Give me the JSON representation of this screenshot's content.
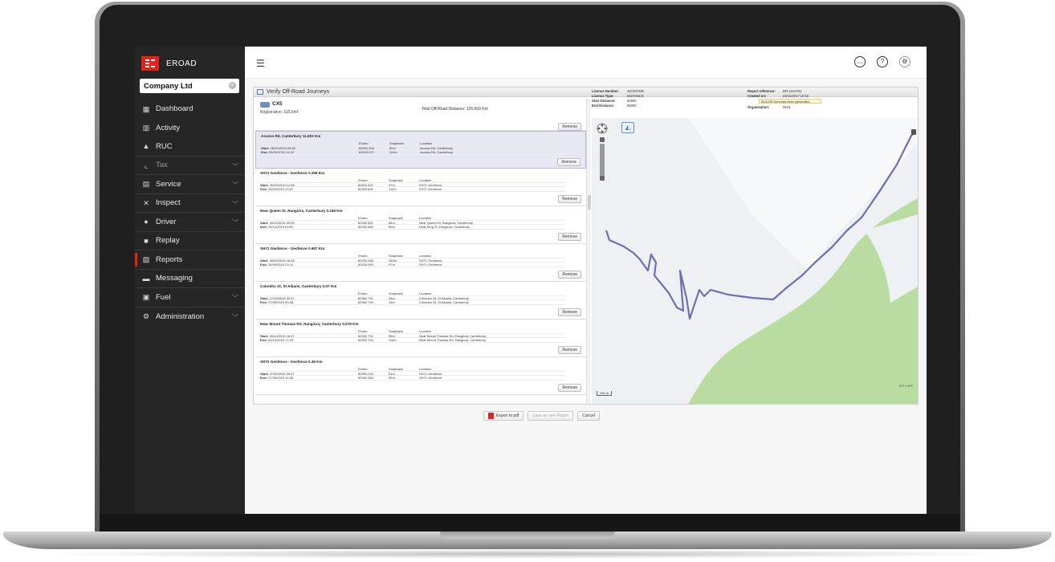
{
  "brand": {
    "name": "EROAD",
    "accent": "#e2231a"
  },
  "company": {
    "name": "Company Ltd"
  },
  "nav": {
    "items": [
      {
        "label": "Dashboard",
        "icon": "dashboard-icon"
      },
      {
        "label": "Activity",
        "icon": "activity-icon"
      },
      {
        "label": "RUC",
        "icon": "ruc-icon"
      },
      {
        "label": "Tax",
        "icon": "tax-icon"
      },
      {
        "label": "Service",
        "icon": "service-icon"
      },
      {
        "label": "Inspect",
        "icon": "inspect-icon"
      },
      {
        "label": "Driver",
        "icon": "driver-icon"
      },
      {
        "label": "Replay",
        "icon": "replay-icon"
      },
      {
        "label": "Reports",
        "icon": "reports-icon"
      },
      {
        "label": "Messaging",
        "icon": "messaging-icon"
      },
      {
        "label": "Fuel",
        "icon": "fuel-icon"
      },
      {
        "label": "Administration",
        "icon": "administration-icon"
      }
    ]
  },
  "panel": {
    "title": "Verify Off-Road Journeys"
  },
  "vehicle": {
    "name": "CX5",
    "registration": "Registration: DZL644",
    "total": "Total Off-Road Distance: 126.663 Km"
  },
  "remove_label": "Remove",
  "headers": {
    "hubo": "Ehubo",
    "snapback": "Snapback",
    "location": "Location"
  },
  "journeys": [
    {
      "title": "Access Rd, Canterbury 11.602 Km",
      "start": {
        "label": "Start:",
        "time": "26/09/2015 09:35",
        "hubo": "82831.904",
        "snap": "80m",
        "loc": "Access Rd, Canterbury"
      },
      "end": {
        "label": "End:",
        "time": "26/09/2015 11:33",
        "hubo": "82843.572",
        "snap": "110m",
        "loc": "Access Rd, Canterbury"
      }
    },
    {
      "title": "SH71 Geofence - Geofence 0.259 Km",
      "start": {
        "label": "Start:",
        "time": "26/09/2015 12:55",
        "hubo": "82920.422",
        "snap": "97m",
        "loc": "SH71 Geofence"
      },
      "end": {
        "label": "End:",
        "time": "26/09/2015 19:21",
        "hubo": "82920.692",
        "snap": "112m",
        "loc": "SH71 Geofence"
      }
    },
    {
      "title": "Near Queen St, Rangiora, Canterbury 0.249 Km",
      "start": {
        "label": "Start:",
        "time": "26/10/2015 09:50",
        "hubo": "82932.601",
        "snap": "84m",
        "loc": "Near Queen St, Rangiora, Canterbury"
      },
      "end": {
        "label": "End:",
        "time": "26/10/2015 09:51",
        "hubo": "82932.660",
        "snap": "89m",
        "loc": "Near King St, Rangiora, Canterbury"
      }
    },
    {
      "title": "SH71 Geofence - Geofence 0.657 Km",
      "start": {
        "label": "Start:",
        "time": "26/09/2015 16:45",
        "hubo": "82934.333",
        "snap": "183m",
        "loc": "SH71 Geofence"
      },
      "end": {
        "label": "End:",
        "time": "26/09/2015 23:14",
        "hubo": "82934.990",
        "snap": "97m",
        "loc": "SH71 Geofence"
      }
    },
    {
      "title": "Colombo St, St Albans, Canterbury 0.07 Km",
      "start": {
        "label": "Start:",
        "time": "27/09/2015 00:47",
        "hubo": "82962.791",
        "snap": "36m",
        "loc": "Colombo St, St Albans, Canterbury"
      },
      "end": {
        "label": "End:",
        "time": "27/09/2015 00:48",
        "hubo": "82962.793",
        "snap": "33m",
        "loc": "Colombo St, St Albans, Canterbury"
      }
    },
    {
      "title": "Near Mount Thomas Rd, Rangiora, Canterbury 0.078 Km",
      "start": {
        "label": "Start:",
        "time": "26/10/2015 16:57",
        "hubo": "82992.701",
        "snap": "95m",
        "loc": "Near Mount Thomas Rd, Rangiora, Canterbury"
      },
      "end": {
        "label": "End:",
        "time": "26/10/2015 17:23",
        "hubo": "82992.794",
        "snap": "114m",
        "loc": "Near Mount Thomas Rd, Rangiora, Canterbury"
      }
    },
    {
      "title": "SH71 Geofence - Geofence 0.35 Km",
      "start": {
        "label": "Start:",
        "time": "27/09/2015 09:47",
        "hubo": "82993.103",
        "snap": "91m",
        "loc": "SH71 Geofence"
      },
      "end": {
        "label": "End:",
        "time": "27/09/2015 10:26",
        "hubo": "82993.383",
        "snap": "95m",
        "loc": "SH71 Geofence"
      }
    }
  ],
  "info": {
    "licence_number_label": "Licence Number:",
    "licence_number": "487297295",
    "licence_type_label": "Licence Type:",
    "licence_type": "DISTANCE",
    "start_distance_label": "Start Distance:",
    "start_distance": "83050",
    "end_distance_label": "End Distance:",
    "end_distance": "86000",
    "report_ref_label": "Report reference:",
    "report_ref": "DR-1244791",
    "created_label": "Created on:",
    "created": "24/11/2017 10:15",
    "badge": "RUCOR form has been generated",
    "organisation_label": "Organisation:",
    "organisation": "Work"
  },
  "map": {
    "scale": "200 m",
    "attribution": "ESTV NPE",
    "route_color": "#6e6fb3",
    "green": "#b9dca0"
  },
  "actions": {
    "export": "Export to pdf",
    "save": "Save as new Report",
    "cancel": "Cancel"
  }
}
